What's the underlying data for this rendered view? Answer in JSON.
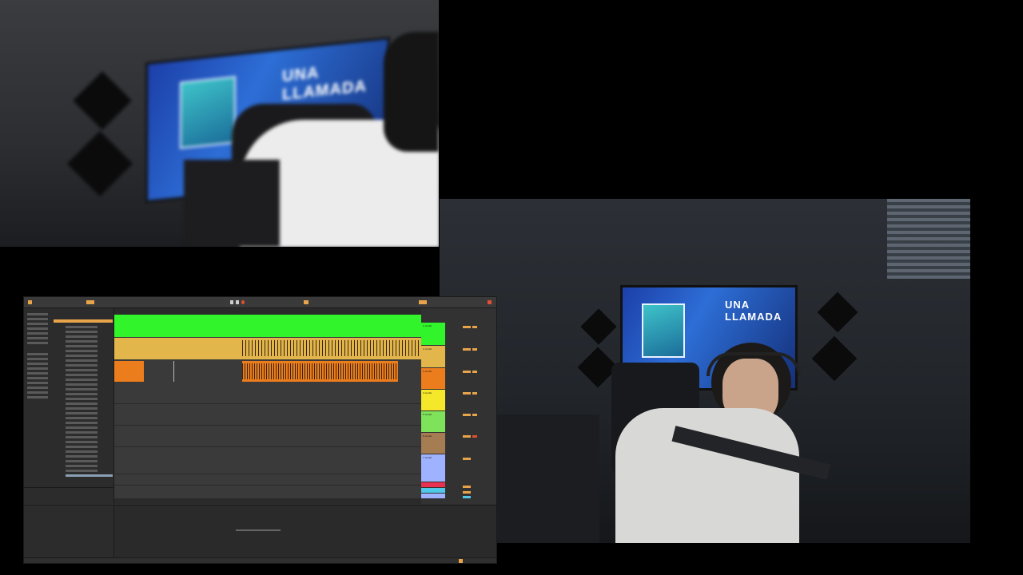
{
  "top_camera": {
    "tv_title": "UNA LLAMADA"
  },
  "right_camera": {
    "tv_title": "UNA LLAMADA"
  },
  "daw": {
    "title": "Ableton Live",
    "tracks": [
      {
        "name": "1 Audio",
        "color": "#31f52a"
      },
      {
        "name": "2 Audio",
        "color": "#e2b64a"
      },
      {
        "name": "3 Audio",
        "color": "#ec7d1d"
      },
      {
        "name": "4 Audio",
        "color": "#f5e72a"
      },
      {
        "name": "5 Audio",
        "color": "#7ee25a"
      },
      {
        "name": "6 Audio",
        "color": "#a67c52"
      },
      {
        "name": "7 Audio",
        "color": "#9fb2ff"
      }
    ],
    "status_left": "",
    "status_right": ""
  }
}
